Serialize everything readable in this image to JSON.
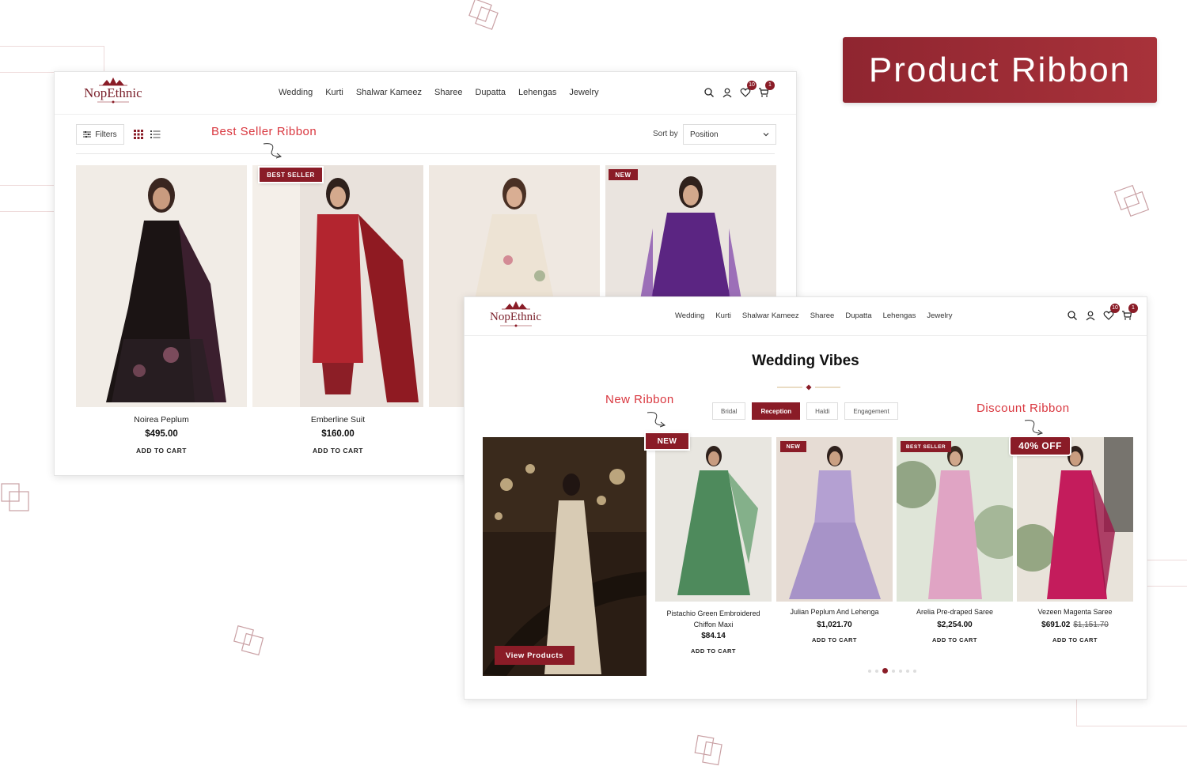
{
  "banner": {
    "title": "Product Ribbon"
  },
  "store": {
    "logo": "NopEthnic"
  },
  "nav": [
    "Wedding",
    "Kurti",
    "Shalwar Kameez",
    "Sharee",
    "Dupatta",
    "Lehengas",
    "Jewelry"
  ],
  "header_icons": {
    "wishlist_count": "10",
    "cart_count": "1"
  },
  "listing": {
    "filters_label": "Filters",
    "sort_label": "Sort by",
    "sort_value": "Position",
    "products": [
      {
        "name": "Noirea Peplum",
        "price": "$495.00",
        "cart": "ADD TO CART"
      },
      {
        "name": "Emberline Suit",
        "price": "$160.00",
        "cart": "ADD TO CART",
        "ribbon": "BEST SELLER"
      },
      {
        "ribbon": ""
      },
      {
        "ribbon": "NEW"
      }
    ]
  },
  "annotations": {
    "best_seller": "Best Seller Ribbon",
    "new": "New Ribbon",
    "discount": "Discount Ribbon"
  },
  "section": {
    "title": "Wedding Vibes",
    "tabs": [
      "Bridal",
      "Reception",
      "Haldi",
      "Engagement"
    ],
    "active_tab": "Reception",
    "view_button": "View Products",
    "products": [
      {
        "name_line1": "Pistachio Green Embroidered",
        "name_line2": "Chiffon Maxi",
        "price": "$84.14",
        "cart": "ADD TO CART",
        "ribbon": "NEW"
      },
      {
        "name_line1": "Julian Peplum And Lehenga",
        "price": "$1,021.70",
        "cart": "ADD TO CART",
        "ribbon": "NEW"
      },
      {
        "name_line1": "Arelia Pre-draped Saree",
        "price": "$2,254.00",
        "cart": "ADD TO CART",
        "ribbon": "BEST SELLER"
      },
      {
        "name_line1": "Vezeen Magenta Saree",
        "price": "$691.02",
        "old_price": "$1,151.70",
        "cart": "ADD TO CART",
        "ribbon": "40% OFF"
      }
    ]
  },
  "colors": {
    "brand": "#8a1c27",
    "annotation": "#d9373f"
  }
}
